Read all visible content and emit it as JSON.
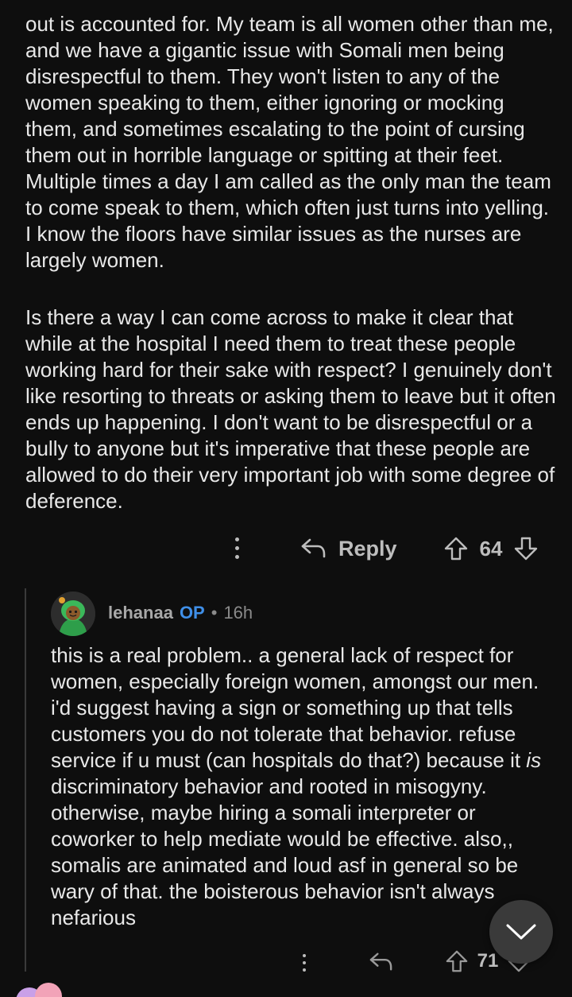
{
  "post": {
    "paragraph1": "out is accounted for. My team is all women other than me, and we have a gigantic issue with Somali men being disrespectful to them. They won't listen to any of the women speaking to them, either ignoring or mocking them, and sometimes escalating to the point of cursing them out in horrible language or spitting at their feet. Multiple times a day I am called as the only man the team to come speak to them, which often just turns into yelling. I know the floors have similar issues as the nurses are largely women.",
    "paragraph2": "Is there a way I can come across to make it clear that while at the hospital I need them to treat these people working hard for their sake with respect? I genuinely don't like resorting to threats or asking them to leave but it often ends up happening. I don't want to be disrespectful or a bully to anyone but it's imperative that these people are allowed to do their very important job with some degree of deference.",
    "actions": {
      "reply_label": "Reply",
      "vote_count": "64"
    }
  },
  "reply": {
    "username": "lehanaa",
    "op_tag": "OP",
    "separator": "•",
    "age": "16h",
    "text_part1": "this is a real problem.. a general lack of respect for women, especially foreign women, amongst our men. i'd suggest having a sign or something up that tells customers you do not tolerate that behavior. refuse service if u must (can hospitals do that?) because it ",
    "text_emphasis": "is",
    "text_part2": " discriminatory behavior and rooted in misogyny. otherwise, maybe hiring a somali interpreter or coworker to help mediate would be effective. also,, somalis are animated and loud asf in general so be wary of that. the boisterous behavior isn't always nefarious",
    "actions": {
      "vote_count": "71"
    }
  },
  "icons": {
    "more": "more-vertical-icon",
    "reply": "reply-arrow-icon",
    "upvote": "upvote-arrow-icon",
    "downvote": "downvote-arrow-icon",
    "collapse": "chevron-down-icon"
  },
  "colors": {
    "background": "#0e0e0e",
    "text": "#e8e8e8",
    "muted": "#bdbdbd",
    "op_accent": "#3f8fe8"
  }
}
